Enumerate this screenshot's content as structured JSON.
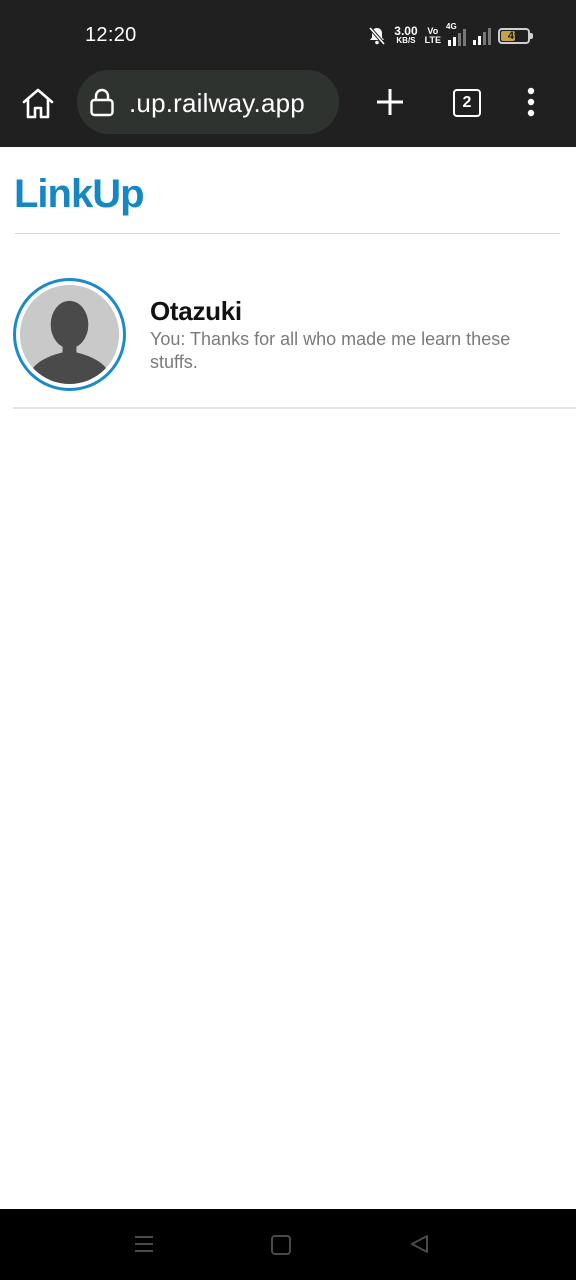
{
  "status_bar": {
    "time": "12:20",
    "net_speed_value": "3.00",
    "net_speed_unit": "KB/S",
    "volte_top": "Vo",
    "volte_bottom": "LTE",
    "network_type": "4G",
    "battery_level": "49",
    "battery_color": "#c7a04a"
  },
  "browser": {
    "url": ".up.railway.app",
    "tab_count": "2",
    "icons": [
      "home-icon",
      "lock-icon",
      "plus-icon",
      "more-vert-icon"
    ]
  },
  "app": {
    "logo": "LinkUp",
    "accent_color": "#1687c5"
  },
  "chats": [
    {
      "name": "Otazuki",
      "preview": "You: Thanks for all who made me learn these stuffs.",
      "avatar": "default-person-avatar"
    }
  ],
  "nav_bar": {
    "icons": [
      "recents-menu-icon",
      "home-square-icon",
      "back-triangle-icon"
    ]
  }
}
